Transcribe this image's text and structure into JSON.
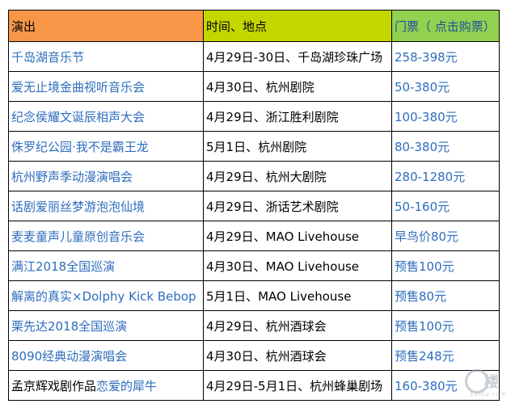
{
  "header": {
    "col1": "演出",
    "col2": "时间、地点",
    "col3": "门票（ 点击购票）"
  },
  "rows": [
    {
      "name": "千岛湖音乐节",
      "info": "4月29日-30日、千岛湖珍珠广场",
      "price": "258-398元"
    },
    {
      "name": "爱无止境金曲视听音乐会",
      "info": "4月30日、杭州剧院",
      "price": "50-380元"
    },
    {
      "name": "纪念侯耀文诞辰相声大会",
      "info": "4月29日、浙江胜利剧院",
      "price": "100-380元"
    },
    {
      "name": "侏罗纪公园·我不是霸王龙",
      "info": "5月1日、杭州剧院",
      "price": "80-380元"
    },
    {
      "name": "杭州野声季动漫演唱会",
      "info": "4月29日、杭州大剧院",
      "price": "280-1280元"
    },
    {
      "name": "话剧爱丽丝梦游泡泡仙境",
      "info": "4月29日、浙话艺术剧院",
      "price": "50-160元"
    },
    {
      "name": "麦麦童声儿童原创音乐会",
      "info": "4月29日、MAO Livehouse",
      "price": "早鸟价80元"
    },
    {
      "name": "满江2018全国巡演",
      "info": "4月30日、MAO Livehouse",
      "price": "预售100元"
    },
    {
      "name": "解离的真实×Dolphy Kick Bebop",
      "info": "5月1日、MAO Livehouse",
      "price": "预售80元"
    },
    {
      "name": "栗先达2018全国巡演",
      "info": "4月29日、杭州酒球会",
      "price": "预售100元"
    },
    {
      "name": "8090经典动漫演唱会",
      "info": "4月30日、杭州酒球会",
      "price": "预售248元"
    },
    {
      "name_prefix": "孟京辉戏剧作品",
      "name": "恋爱的犀牛",
      "info": "4月29日-5月1日、杭州蜂巢剧场",
      "price": "160-380元"
    }
  ],
  "watermark": {
    "glyph": "楼",
    "sub": "19lou.com"
  },
  "colors": {
    "header_col1": "#f79646",
    "header_col2": "#c4d600",
    "header_col3": "#92d050",
    "link": "#2e6dbd"
  }
}
